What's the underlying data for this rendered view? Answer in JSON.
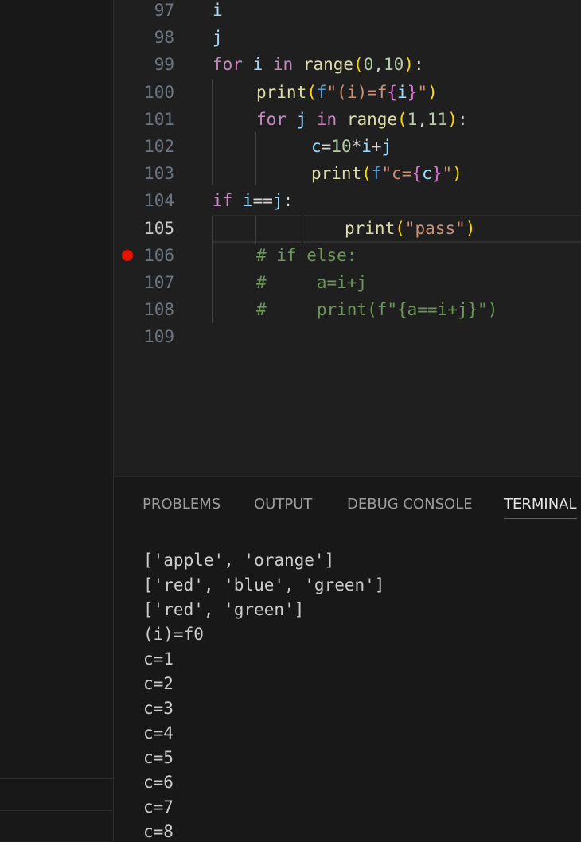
{
  "editor": {
    "active_line": "105",
    "breakpoint_line": "106",
    "lines": [
      {
        "num": "97",
        "tokens": [
          {
            "t": "i",
            "c": "var"
          }
        ]
      },
      {
        "num": "98",
        "tokens": [
          {
            "t": "j",
            "c": "var"
          }
        ]
      },
      {
        "num": "99",
        "tokens": [
          {
            "t": "for ",
            "c": "kw"
          },
          {
            "t": "i ",
            "c": "var"
          },
          {
            "t": "in ",
            "c": "kw"
          },
          {
            "t": "range",
            "c": "fn"
          },
          {
            "t": "(",
            "c": "p1"
          },
          {
            "t": "0",
            "c": "num"
          },
          {
            "t": ",",
            "c": "plain"
          },
          {
            "t": "10",
            "c": "num"
          },
          {
            "t": ")",
            "c": "p1"
          },
          {
            "t": ":",
            "c": "plain"
          }
        ]
      },
      {
        "num": "100",
        "tokens": [
          {
            "t": "print",
            "c": "fn"
          },
          {
            "t": "(",
            "c": "p1"
          },
          {
            "t": "f",
            "c": "fpre"
          },
          {
            "t": "\"(i)=f",
            "c": "str"
          },
          {
            "t": "{",
            "c": "p2"
          },
          {
            "t": "i",
            "c": "var"
          },
          {
            "t": "}",
            "c": "p2"
          },
          {
            "t": "\"",
            "c": "str"
          },
          {
            "t": ")",
            "c": "p1"
          }
        ]
      },
      {
        "num": "101",
        "tokens": [
          {
            "t": "for ",
            "c": "kw"
          },
          {
            "t": "j ",
            "c": "var"
          },
          {
            "t": "in ",
            "c": "kw"
          },
          {
            "t": "range",
            "c": "fn"
          },
          {
            "t": "(",
            "c": "p1"
          },
          {
            "t": "1",
            "c": "num"
          },
          {
            "t": ",",
            "c": "plain"
          },
          {
            "t": "11",
            "c": "num"
          },
          {
            "t": ")",
            "c": "p1"
          },
          {
            "t": ":",
            "c": "plain"
          }
        ]
      },
      {
        "num": "102",
        "tokens": [
          {
            "t": "c",
            "c": "var"
          },
          {
            "t": "=",
            "c": "plain"
          },
          {
            "t": "10",
            "c": "num"
          },
          {
            "t": "*",
            "c": "plain"
          },
          {
            "t": "i",
            "c": "var"
          },
          {
            "t": "+",
            "c": "plain"
          },
          {
            "t": "j",
            "c": "var"
          }
        ]
      },
      {
        "num": "103",
        "tokens": [
          {
            "t": "print",
            "c": "fn"
          },
          {
            "t": "(",
            "c": "p1"
          },
          {
            "t": "f",
            "c": "fpre"
          },
          {
            "t": "\"c=",
            "c": "str"
          },
          {
            "t": "{",
            "c": "p2"
          },
          {
            "t": "c",
            "c": "var"
          },
          {
            "t": "}",
            "c": "p2"
          },
          {
            "t": "\"",
            "c": "str"
          },
          {
            "t": ")",
            "c": "p1"
          }
        ]
      },
      {
        "num": "104",
        "tokens": [
          {
            "t": "if ",
            "c": "kw"
          },
          {
            "t": "i",
            "c": "var"
          },
          {
            "t": "==",
            "c": "plain"
          },
          {
            "t": "j",
            "c": "var"
          },
          {
            "t": ":",
            "c": "plain"
          }
        ]
      },
      {
        "num": "105",
        "tokens": [
          {
            "t": "print",
            "c": "fn"
          },
          {
            "t": "(",
            "c": "p1"
          },
          {
            "t": "\"pass\"",
            "c": "str"
          },
          {
            "t": ")",
            "c": "p1"
          }
        ]
      },
      {
        "num": "106",
        "tokens": [
          {
            "t": "# if else:",
            "c": "cmt"
          }
        ]
      },
      {
        "num": "107",
        "tokens": [
          {
            "t": "#     a=i+j",
            "c": "cmt"
          }
        ]
      },
      {
        "num": "108",
        "tokens": [
          {
            "t": "#     print(f\"{a==i+j}\")",
            "c": "cmt"
          }
        ]
      },
      {
        "num": "109",
        "tokens": []
      }
    ]
  },
  "panel": {
    "tabs": [
      {
        "label": "PROBLEMS",
        "active": false
      },
      {
        "label": "OUTPUT",
        "active": false
      },
      {
        "label": "DEBUG CONSOLE",
        "active": false
      },
      {
        "label": "TERMINAL",
        "active": true
      }
    ],
    "terminal_lines": [
      "['apple', 'orange']",
      "['red', 'blue', 'green']",
      "['red', 'green']",
      "(i)=f0",
      "c=1",
      "c=2",
      "c=3",
      "c=4",
      "c=5",
      "c=6",
      "c=7",
      "c=8"
    ]
  },
  "colors": {
    "breakpoint": "#e51400",
    "active_tab_underline": "#0078d4",
    "keyword": "#c586c0",
    "string": "#ce9178",
    "comment": "#6a9955"
  }
}
